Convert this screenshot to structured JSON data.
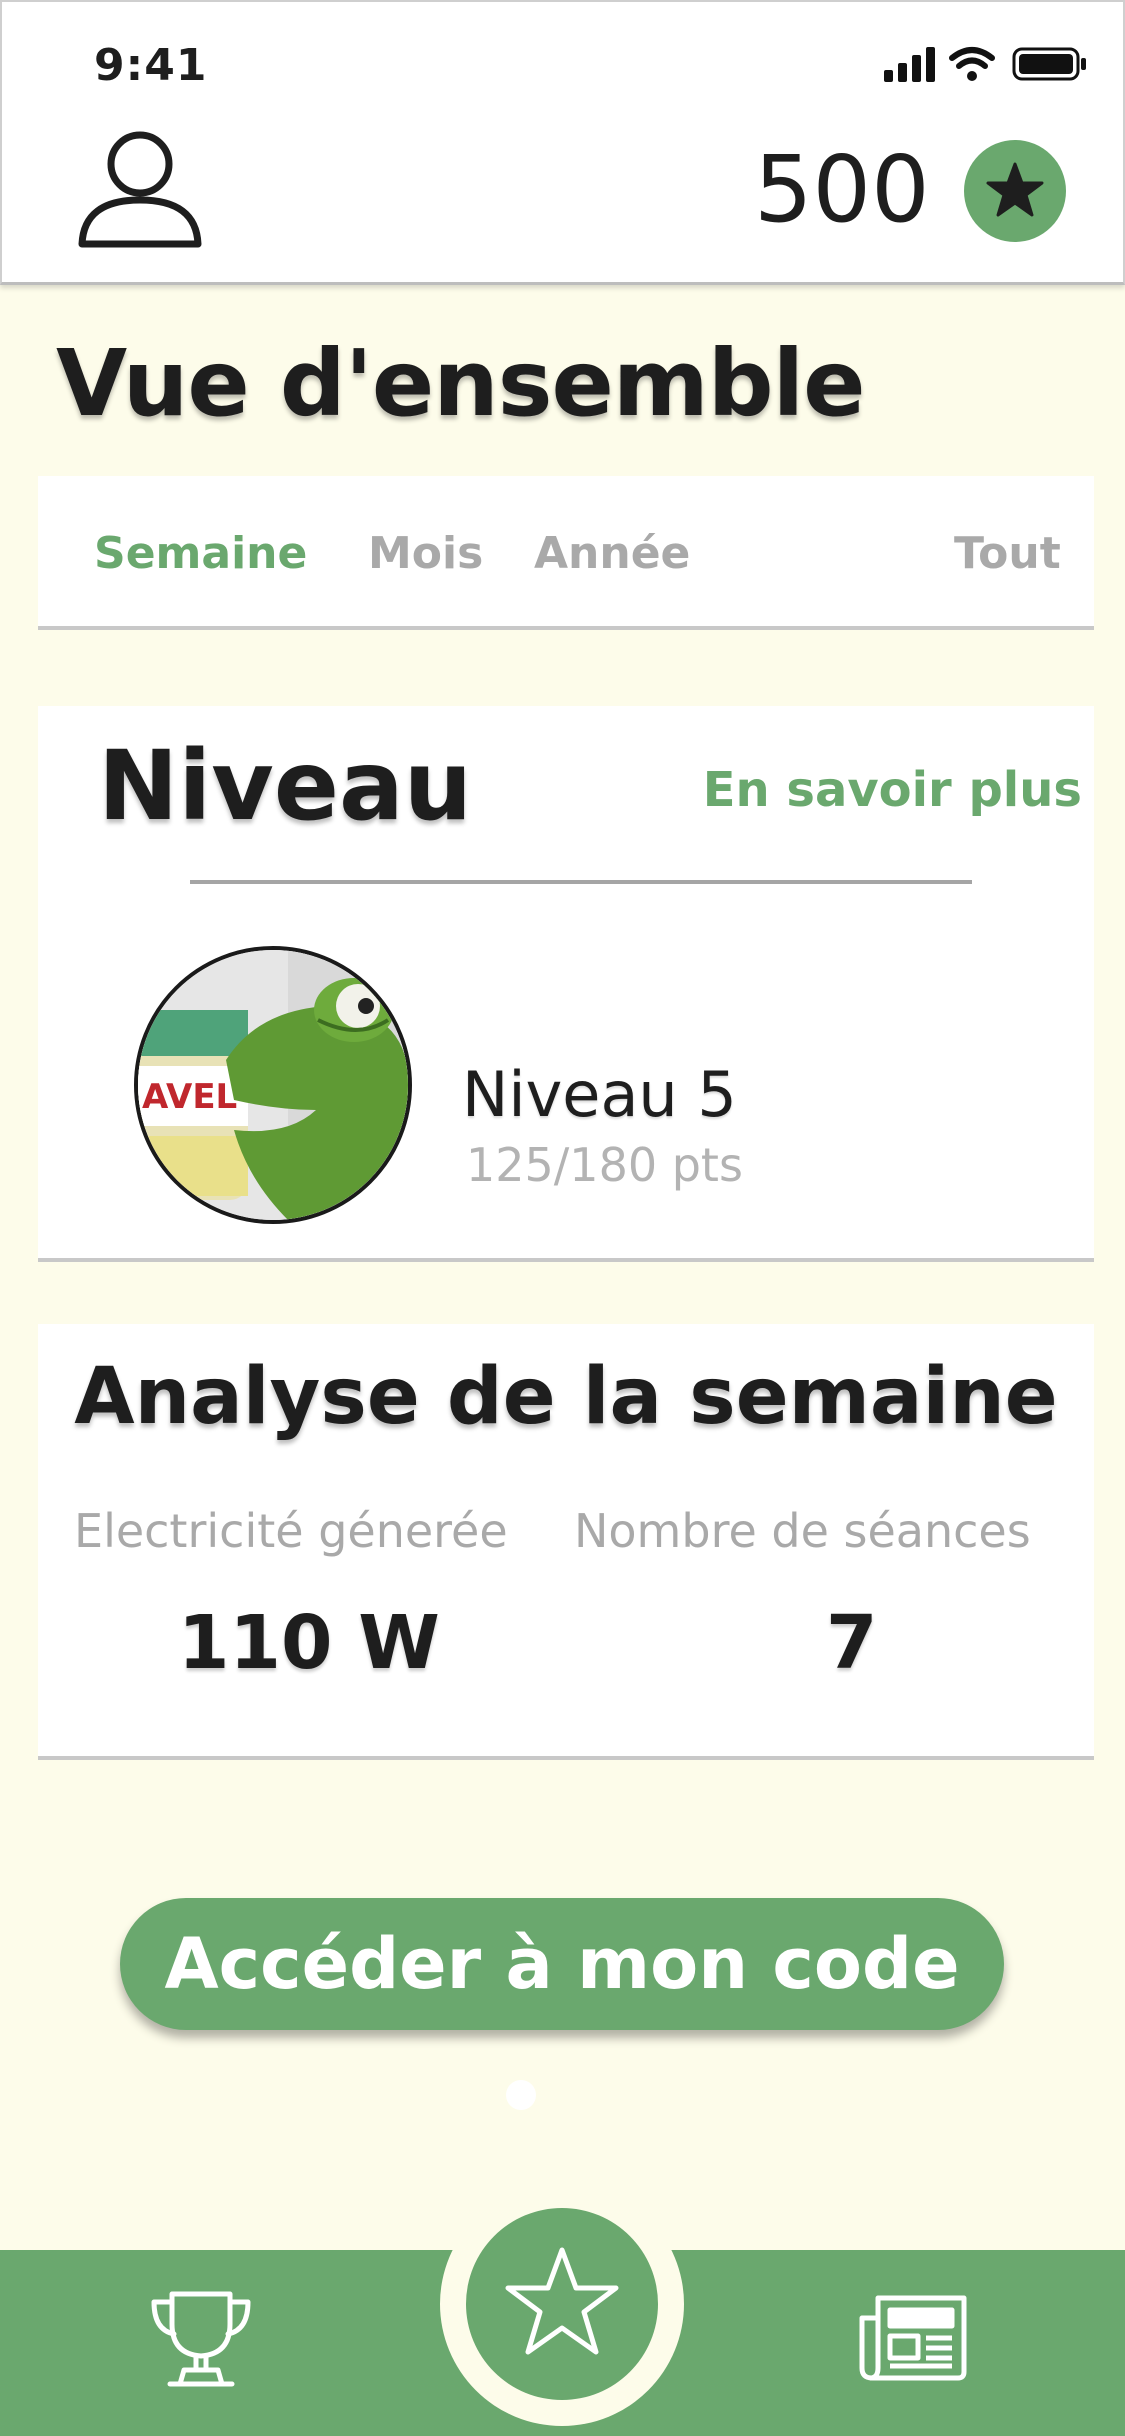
{
  "status_bar": {
    "time": "9:41"
  },
  "header": {
    "points": "500"
  },
  "page": {
    "title": "Vue d'ensemble"
  },
  "tabs": [
    {
      "label": "Semaine",
      "active": true
    },
    {
      "label": "Mois",
      "active": false
    },
    {
      "label": "Année",
      "active": false
    },
    {
      "label": "Tout",
      "active": false
    }
  ],
  "level": {
    "title": "Niveau",
    "learn_more": "En savoir plus",
    "name": "Niveau 5",
    "points": "125/180 pts",
    "progress": 0.694
  },
  "analysis": {
    "title": "Analyse de la semaine",
    "metrics": [
      {
        "label": "Electricité génerée",
        "value": "110 W"
      },
      {
        "label": "Nombre de séances",
        "value": "7"
      }
    ]
  },
  "cta": {
    "label": "Accéder à mon code"
  },
  "nav": {
    "items": [
      "trophy-icon",
      "star-icon",
      "newspaper-icon"
    ]
  },
  "colors": {
    "accent": "#6aa86e",
    "background": "#fdfcea",
    "muted": "#a9a9a9"
  }
}
